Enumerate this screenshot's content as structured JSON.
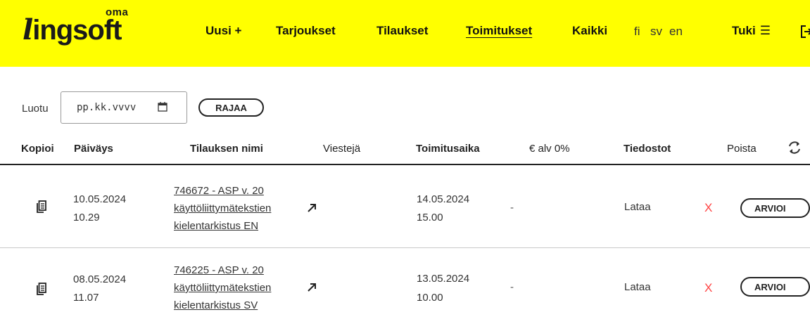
{
  "brand": {
    "sup": "oma",
    "name_l": "l",
    "name_rest": "ingsoft"
  },
  "nav": {
    "items": [
      "Uusi +",
      "Tarjoukset",
      "Tilaukset",
      "Toimitukset",
      "Kaikki"
    ],
    "active": "Toimitukset",
    "languages": [
      "fi",
      "sv",
      "en"
    ],
    "support": "Tuki",
    "support_menu_glyph": "☰",
    "logout_icon": "logout-icon"
  },
  "filter": {
    "label": "Luotu",
    "date_placeholder": "pp.kk.vvvv",
    "button": "RAJAA"
  },
  "table": {
    "headers": {
      "copy": "Kopioi",
      "date": "Päiväys",
      "name": "Tilauksen nimi",
      "messages": "Viestejä",
      "delivery": "Toimitusaika",
      "price": "€ alv 0%",
      "files": "Tiedostot",
      "delete": "Poista"
    },
    "rows": [
      {
        "date": "10.05.2024",
        "time": "10.29",
        "name_lines": [
          "746672 - ASP v. 20",
          "käyttöliittymätekstien",
          "kielentarkistus EN"
        ],
        "delivery_date": "14.05.2024",
        "delivery_time": "15.00",
        "price": "-",
        "files": "Lataa",
        "delete": "X",
        "action": "ARVIOI"
      },
      {
        "date": "08.05.2024",
        "time": "11.07",
        "name_lines": [
          "746225 - ASP v. 20",
          "käyttöliittymätekstien",
          "kielentarkistus SV"
        ],
        "delivery_date": "13.05.2024",
        "delivery_time": "10.00",
        "price": "-",
        "files": "Lataa",
        "delete": "X",
        "action": "ARVIOI"
      }
    ]
  },
  "colors": {
    "header_bg": "#ffff00",
    "delete": "#ff4444",
    "text": "#222222"
  }
}
